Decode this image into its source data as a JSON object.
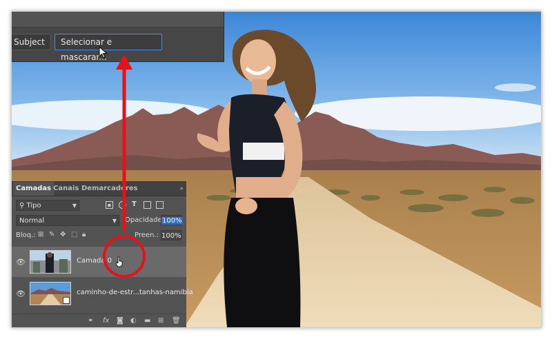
{
  "options_bar": {
    "subject_label": "Subject",
    "select_mask_label": "Selecionar e mascarar..."
  },
  "layers_panel": {
    "tabs": [
      {
        "label": "Camadas",
        "active": true
      },
      {
        "label": "Canais",
        "active": false
      },
      {
        "label": "Demarcadores",
        "active": false
      }
    ],
    "menu_icon": "»",
    "filter_type": "Tipo",
    "blend_mode": "Normal",
    "opacity_label": "Opacidade:",
    "opacity_value": "100%",
    "lock_label": "Bloq.:",
    "fill_label": "Preen.:",
    "fill_value": "100%",
    "layers": [
      {
        "name": "Camada 0",
        "selected": true
      },
      {
        "name": "caminho-de-estr...tanhas-namibia",
        "selected": false
      }
    ]
  },
  "colors": {
    "panel_bg": "#535353",
    "highlight_blue": "#2a6cd4",
    "annotation_red": "#e4131b"
  }
}
